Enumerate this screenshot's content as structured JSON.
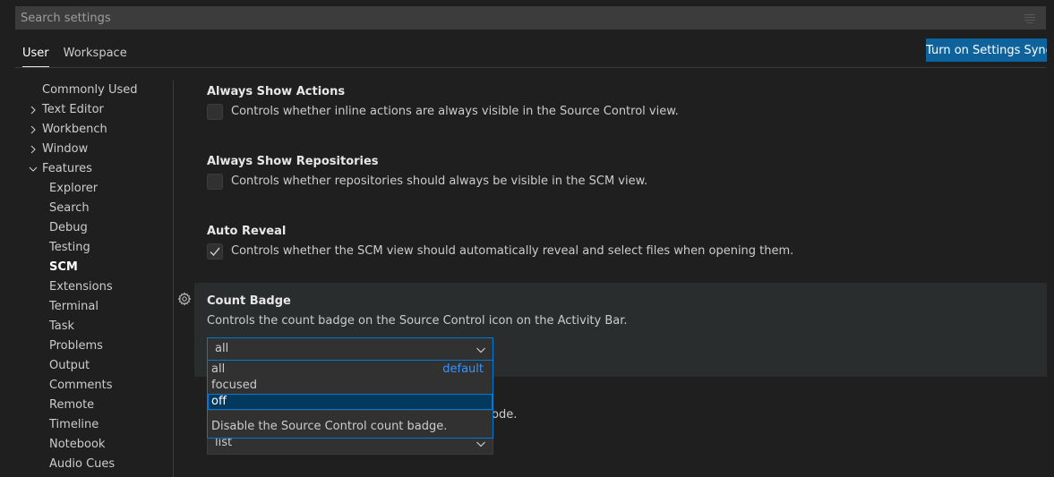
{
  "search": {
    "placeholder": "Search settings"
  },
  "tabs": [
    {
      "label": "User"
    },
    {
      "label": "Workspace"
    }
  ],
  "sync_button": "Turn on Settings Sync",
  "toc": {
    "items": [
      {
        "label": "Commonly Used"
      },
      {
        "label": "Text Editor"
      },
      {
        "label": "Workbench"
      },
      {
        "label": "Window"
      },
      {
        "label": "Features"
      },
      {
        "label": "Explorer"
      },
      {
        "label": "Search"
      },
      {
        "label": "Debug"
      },
      {
        "label": "Testing"
      },
      {
        "label": "SCM"
      },
      {
        "label": "Extensions"
      },
      {
        "label": "Terminal"
      },
      {
        "label": "Task"
      },
      {
        "label": "Problems"
      },
      {
        "label": "Output"
      },
      {
        "label": "Comments"
      },
      {
        "label": "Remote"
      },
      {
        "label": "Timeline"
      },
      {
        "label": "Notebook"
      },
      {
        "label": "Audio Cues"
      }
    ]
  },
  "settings": {
    "always_show_actions": {
      "title": "Always Show Actions",
      "description": "Controls whether inline actions are always visible in the Source Control view.",
      "checked": false
    },
    "always_show_repositories": {
      "title": "Always Show Repositories",
      "description": "Controls whether repositories should always be visible in the SCM view.",
      "checked": false
    },
    "auto_reveal": {
      "title": "Auto Reveal",
      "description": "Controls whether the SCM view should automatically reveal and select files when opening them.",
      "checked": true
    },
    "count_badge": {
      "title": "Count Badge",
      "description": "Controls the count badge on the Source Control icon on the Activity Bar.",
      "value": "all",
      "options": [
        {
          "label": "all",
          "tag": "default"
        },
        {
          "label": "focused"
        },
        {
          "label": "off"
        }
      ],
      "highlighted_option_description": "Disable the Source Control count badge."
    },
    "next_setting": {
      "partial_description": "ode.",
      "value": "list"
    }
  },
  "colors": {
    "accent": "#0078d4",
    "sync_button": "#0e639c",
    "default_tag": "#3794ff"
  }
}
